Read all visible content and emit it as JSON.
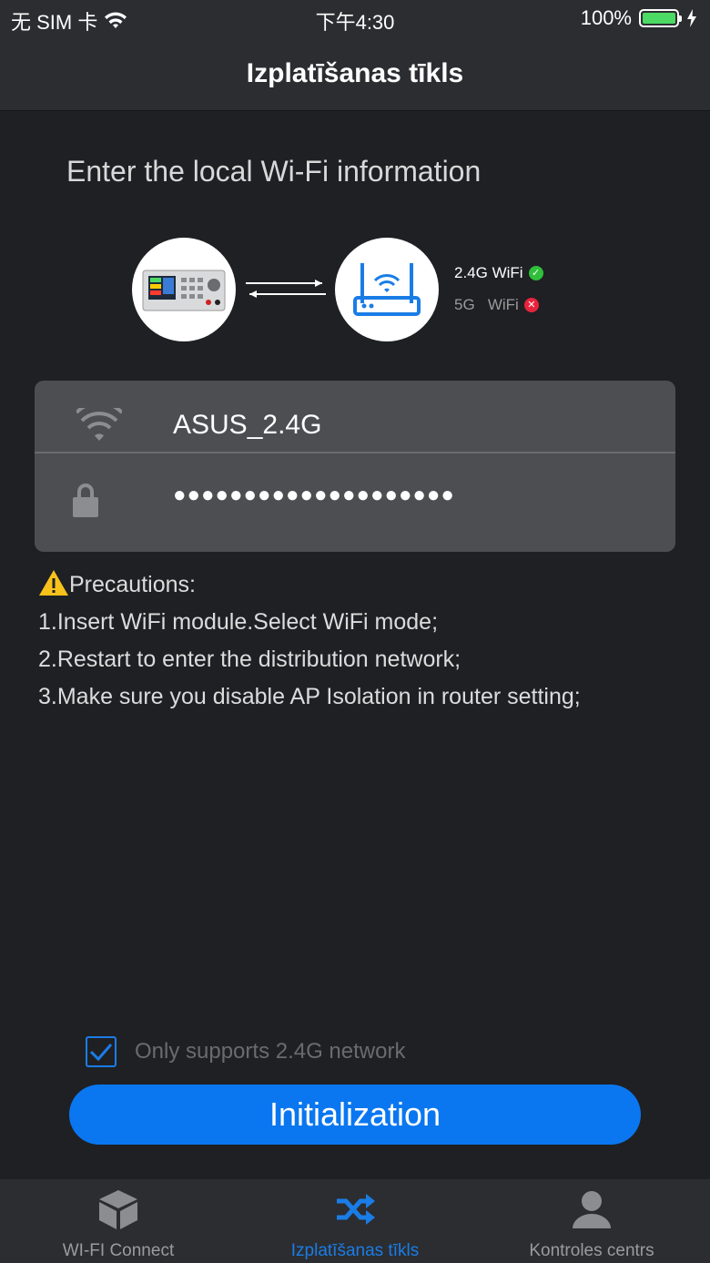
{
  "status_bar": {
    "carrier": "无 SIM 卡",
    "time": "下午4:30",
    "battery": "100%"
  },
  "nav": {
    "title": "Izplatīšanas tīkls"
  },
  "page": {
    "section_title": "Enter the local Wi-Fi information"
  },
  "diagram": {
    "band_24_label": "2.4G WiFi",
    "band_5_label": "5G   WiFi"
  },
  "form": {
    "ssid": "ASUS_2.4G",
    "password_mask": "●●●●●●●●●●●●●●●●●●●●"
  },
  "precautions": {
    "title": "Precautions:",
    "items": [
      "1.Insert WiFi module.Select WiFi mode;",
      "2.Restart to enter the distribution network;",
      "3.Make sure you disable AP Isolation in router setting;"
    ]
  },
  "checkbox": {
    "label": "Only supports 2.4G network",
    "checked": true
  },
  "button": {
    "label": "Initialization"
  },
  "tabs": [
    {
      "label": "WI-FI Connect",
      "icon": "cube-icon",
      "active": false
    },
    {
      "label": "Izplatīšanas tīkls",
      "icon": "shuffle-icon",
      "active": true
    },
    {
      "label": "Kontroles centrs",
      "icon": "user-icon",
      "active": false
    }
  ],
  "colors": {
    "accent": "#0a77f0",
    "success": "#2fbf3a",
    "error": "#e8243c",
    "background": "#1f2024"
  }
}
